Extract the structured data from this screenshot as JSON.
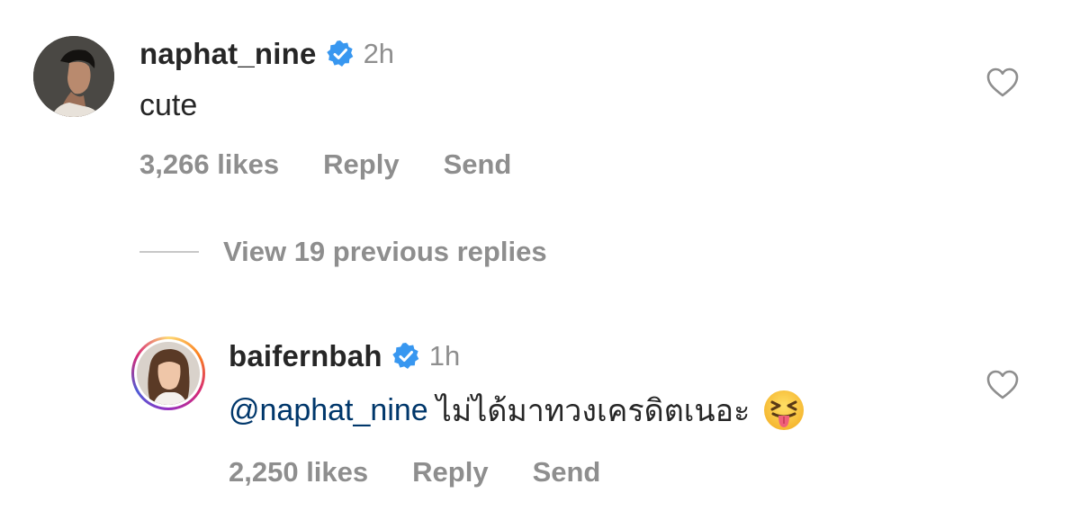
{
  "comments": [
    {
      "username": "naphat_nine",
      "time": "2h",
      "text": "cute",
      "likes": "3,266 likes",
      "reply_label": "Reply",
      "send_label": "Send",
      "verified": true
    },
    {
      "username": "baifernbah",
      "time": "1h",
      "mention": "@naphat_nine",
      "text": "ไม่ได้มาทวงเครดิตเนอะ",
      "emoji": "squinting-face-with-tongue",
      "likes": "2,250 likes",
      "reply_label": "Reply",
      "send_label": "Send",
      "verified": true,
      "has_story_ring": true
    }
  ],
  "view_replies": {
    "label": "View 19 previous replies"
  },
  "colors": {
    "verified_blue": "#3897f0",
    "mention_blue": "#00376b",
    "muted_text": "#8e8e8e",
    "primary_text": "#262626"
  },
  "icons": {
    "like": "heart-outline-icon",
    "verified": "verified-badge-icon"
  }
}
